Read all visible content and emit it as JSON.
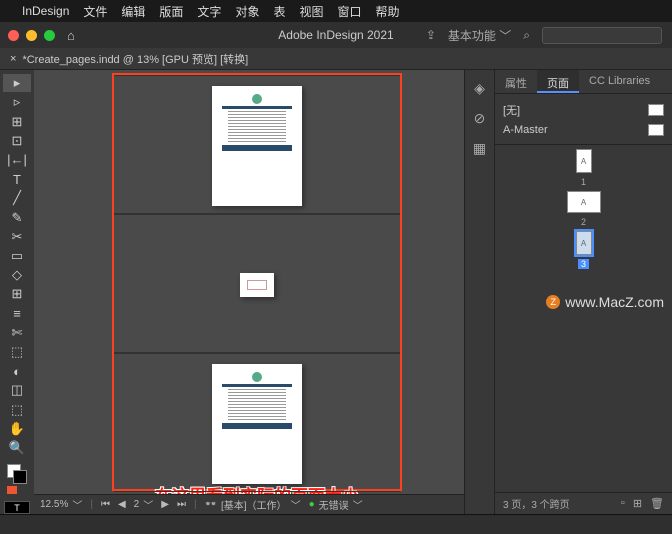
{
  "menubar": {
    "apple": "",
    "items": [
      "InDesign",
      "文件",
      "编辑",
      "版面",
      "文字",
      "对象",
      "表",
      "视图",
      "窗口",
      "帮助"
    ]
  },
  "titlebar": {
    "title": "Adobe InDesign 2021",
    "workspace": "基本功能"
  },
  "doctab": {
    "label": "*Create_pages.indd @ 13% [GPU 预览] [转换]"
  },
  "tools": [
    "▸",
    "▹",
    "⊞",
    "⊡",
    "|←|",
    "T",
    "╱",
    "✎",
    "✂",
    "▭",
    "◇",
    "⊞",
    "≡",
    "✄",
    "⬚",
    "◐",
    "◫",
    "⬚",
    "✋",
    "🔍"
  ],
  "mode_label": "T",
  "annotation": "在这里看到实际的页面大小",
  "statusbar": {
    "zoom": "12.5%",
    "page": "2",
    "profile": "[基本]（工作）",
    "errors": "无错误"
  },
  "panel": {
    "tabs": [
      "属性",
      "页面",
      "CC Libraries"
    ],
    "active_tab": 1,
    "masters": [
      {
        "name": "[无]"
      },
      {
        "name": "A-Master"
      }
    ],
    "pages": [
      {
        "num": "1",
        "label": "A"
      },
      {
        "num": "2",
        "label": "A"
      },
      {
        "num": "3",
        "label": "A",
        "selected": true
      }
    ],
    "footer_status": "3 页，3 个跨页"
  },
  "watermark": {
    "text": "www.MacZ.com",
    "badge": "Z"
  }
}
